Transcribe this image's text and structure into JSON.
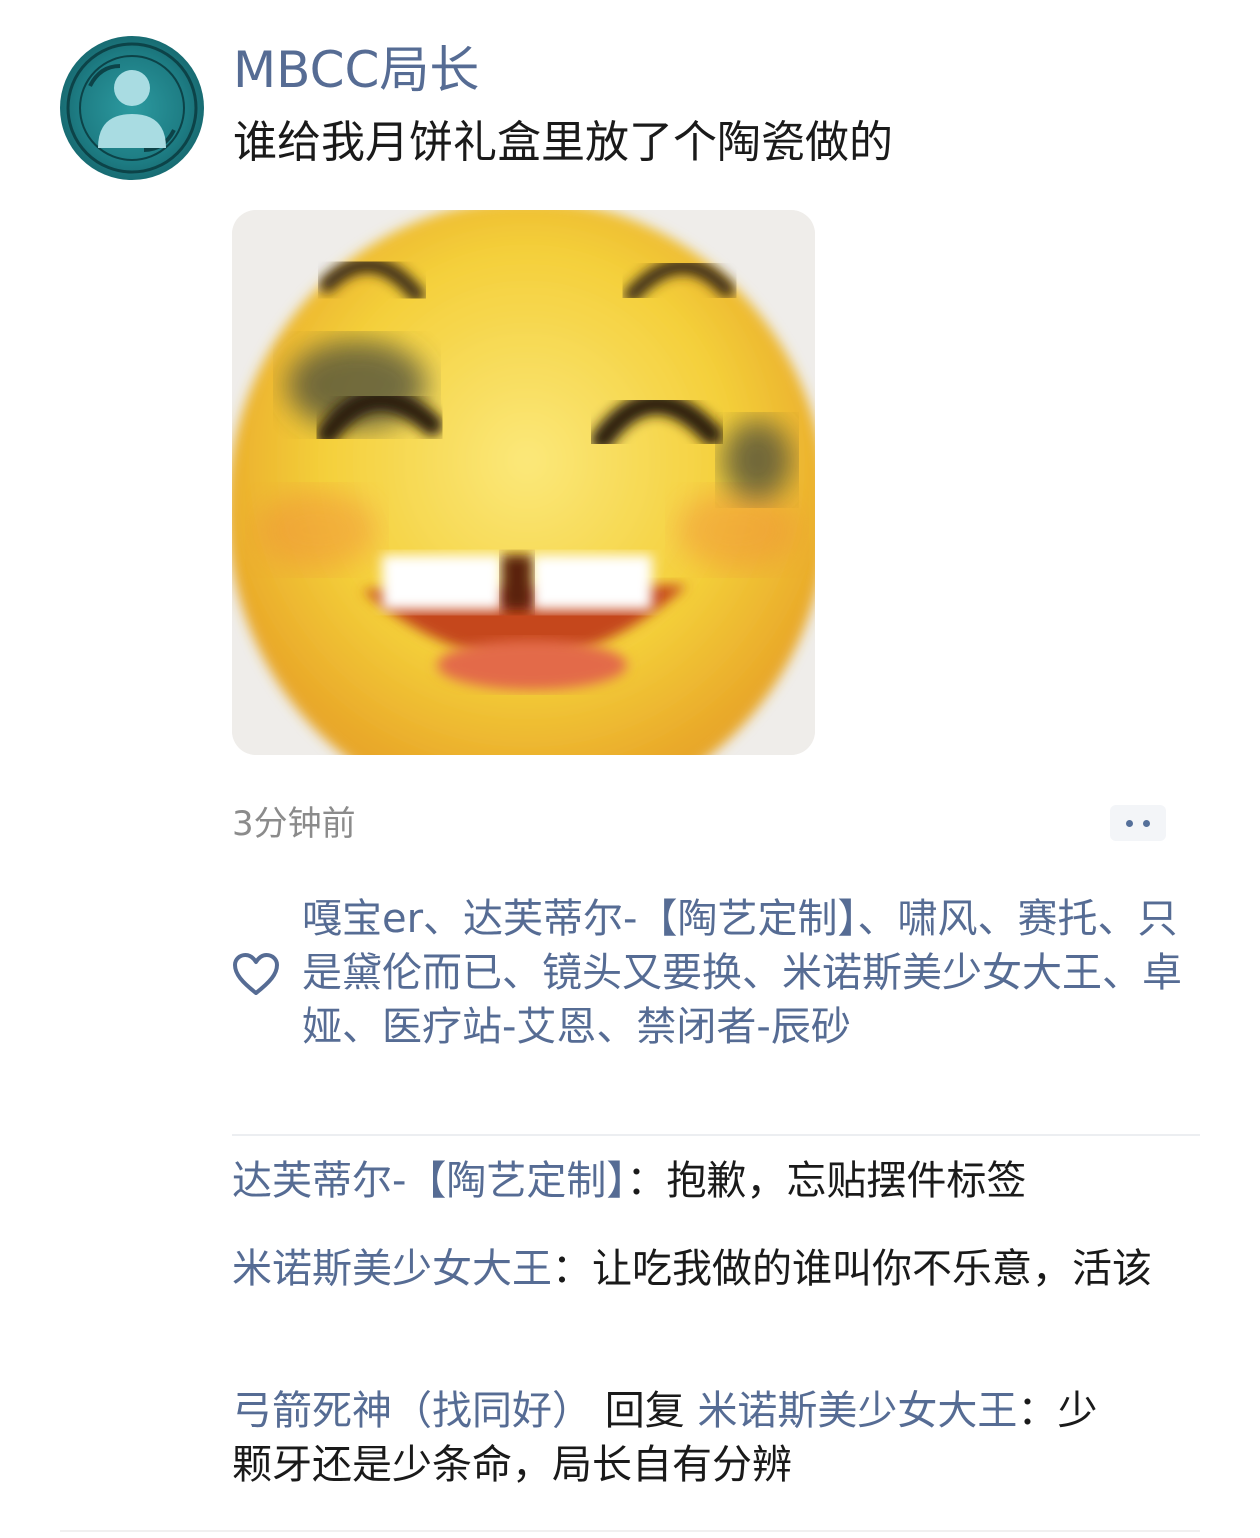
{
  "post": {
    "author": "MBCC局长",
    "text": "谁给我月饼礼盒里放了个陶瓷做的",
    "time": "3分钟前"
  },
  "icons": {
    "avatar": "person-silhouette-on-teal-seal",
    "more": "two-dots-icon",
    "like": "heart-outline-icon"
  },
  "colors": {
    "link": "#566c94",
    "text": "#1a1a1a",
    "muted": "#8b8b8b"
  },
  "likes": {
    "names": "嘎宝er、达芙蒂尔-【陶艺定制】、啸风、赛托、只是黛伦而已、镜头又要换、米诺斯美少女大王、卓娅、医疗站-艾恩、禁闭者-辰砂"
  },
  "comments": [
    {
      "author": "达芙蒂尔-【陶艺定制】",
      "sep": "：",
      "text": "抱歉，忘贴摆件标签"
    },
    {
      "author": "米诺斯美少女大王",
      "sep": "：",
      "text": "让吃我做的谁叫你不乐意，活该"
    },
    {
      "author": "弓箭死神（找同好）",
      "reply_word": " 回复 ",
      "reply_to": "米诺斯美少女大王",
      "sep": "：",
      "text": "少颗牙还是少条命，局长自有分辨"
    }
  ]
}
